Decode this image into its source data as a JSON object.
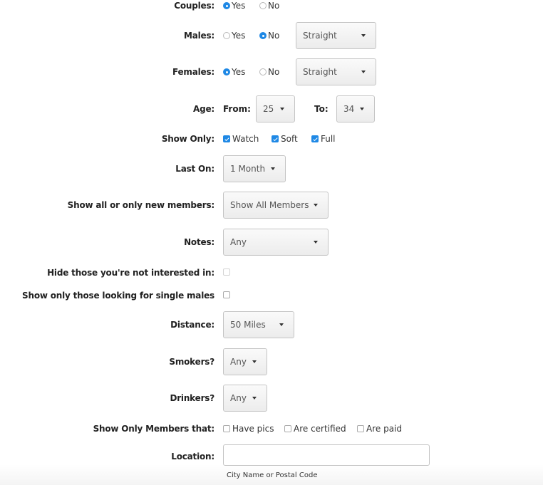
{
  "couples": {
    "label": "Couples:",
    "options": [
      {
        "label": "Yes",
        "selected": true
      },
      {
        "label": "No",
        "selected": false
      }
    ]
  },
  "males": {
    "label": "Males:",
    "options": [
      {
        "label": "Yes",
        "selected": false
      },
      {
        "label": "No",
        "selected": true
      }
    ],
    "orientation": "Straight"
  },
  "females": {
    "label": "Females:",
    "options": [
      {
        "label": "Yes",
        "selected": true
      },
      {
        "label": "No",
        "selected": false
      }
    ],
    "orientation": "Straight"
  },
  "age": {
    "label": "Age:",
    "from_label": "From:",
    "from_value": "25",
    "to_label": "To:",
    "to_value": "34"
  },
  "show_only": {
    "label": "Show Only:",
    "options": [
      {
        "label": "Watch",
        "checked": true
      },
      {
        "label": "Soft",
        "checked": true
      },
      {
        "label": "Full",
        "checked": true
      }
    ]
  },
  "last_on": {
    "label": "Last On:",
    "value": "1 Month"
  },
  "new_members": {
    "label": "Show all or only new members:",
    "value": "Show All Members"
  },
  "notes": {
    "label": "Notes:",
    "value": "Any"
  },
  "hide_not_interested": {
    "label": "Hide those you're not interested in:",
    "checked": false
  },
  "single_males": {
    "label": "Show only those looking for single males",
    "checked": false
  },
  "distance": {
    "label": "Distance:",
    "value": "50 Miles"
  },
  "smokers": {
    "label": "Smokers?",
    "value": "Any"
  },
  "drinkers": {
    "label": "Drinkers?",
    "value": "Any"
  },
  "members_that": {
    "label": "Show Only Members that:",
    "options": [
      {
        "label": "Have pics",
        "checked": false
      },
      {
        "label": "Are certified",
        "checked": false
      },
      {
        "label": "Are paid",
        "checked": false
      }
    ]
  },
  "location": {
    "label": "Location:",
    "value": "",
    "hint": "City Name or Postal Code"
  }
}
